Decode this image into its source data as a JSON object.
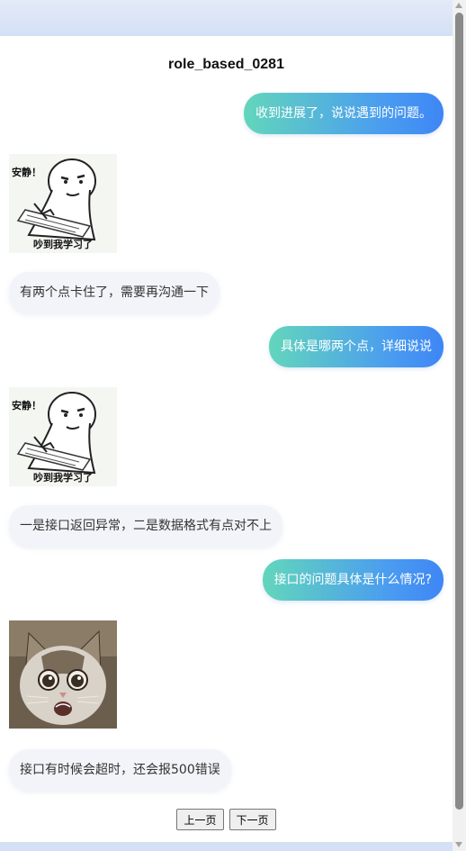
{
  "chat": {
    "title": "role_based_0281",
    "messages": [
      {
        "side": "right",
        "type": "text",
        "text": "收到进展了，说说遇到的问题。"
      },
      {
        "side": "left",
        "type": "sticker",
        "sticker_icon": "studying-meme-sticker",
        "caption": "吵到我学习了",
        "tag": "安静！"
      },
      {
        "side": "left",
        "type": "text",
        "text": "有两个点卡住了，需要再沟通一下"
      },
      {
        "side": "right",
        "type": "text",
        "text": "具体是哪两个点，详细说说"
      },
      {
        "side": "left",
        "type": "sticker",
        "sticker_icon": "studying-meme-sticker",
        "caption": "吵到我学习了",
        "tag": "安静！"
      },
      {
        "side": "left",
        "type": "text",
        "text": "一是接口返回异常，二是数据格式有点对不上"
      },
      {
        "side": "right",
        "type": "text",
        "text": "接口的问题具体是什么情况?"
      },
      {
        "side": "left",
        "type": "image",
        "sticker_icon": "shocked-cat-sticker"
      },
      {
        "side": "left",
        "type": "text",
        "text": "接口有时候会超时，还会报500错误"
      }
    ]
  },
  "pager": {
    "prev_label": "上一页",
    "next_label": "下一页"
  },
  "colors": {
    "bubble_right_gradient_start": "#63d6bc",
    "bubble_right_gradient_end": "#3e86f5",
    "bubble_left_bg": "#f2f4f9",
    "page_bg": "#dfe7f6"
  }
}
